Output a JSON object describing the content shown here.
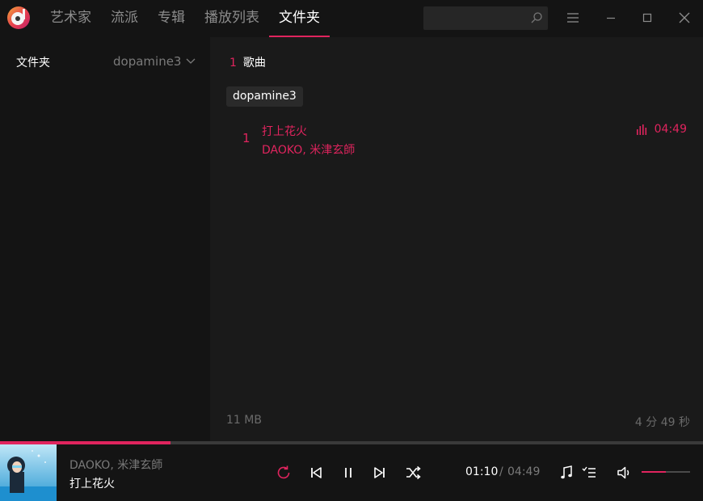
{
  "nav": {
    "items": [
      "艺术家",
      "流派",
      "专辑",
      "播放列表",
      "文件夹"
    ],
    "active_index": 4
  },
  "search": {
    "placeholder": "",
    "value": ""
  },
  "sidebar": {
    "label": "文件夹",
    "selected_folder": "dopamine3"
  },
  "main": {
    "song_count": "1",
    "song_count_label": "歌曲",
    "folder_chip": "dopamine3",
    "tracks": [
      {
        "number": "1",
        "title": "打上花火",
        "artist": "DAOKO, 米津玄師",
        "duration": "04:49",
        "playing": true
      }
    ],
    "total_size": "11 MB",
    "total_duration": "4 分 49 秒"
  },
  "player": {
    "artist": "DAOKO, 米津玄師",
    "title": "打上花火",
    "current_time": "01:10",
    "separator": "/",
    "total_time": "04:49",
    "progress_fraction": 0.243,
    "volume_fraction": 0.5
  },
  "colors": {
    "accent": "#e0245e",
    "background": "#1a1a1a",
    "panel": "#141414"
  },
  "icons": [
    "app-logo-icon",
    "search-icon",
    "menu-icon",
    "minimize-icon",
    "maximize-icon",
    "close-icon",
    "chevron-down-icon",
    "equalizer-icon",
    "album-cover",
    "repeat-icon",
    "previous-icon",
    "pause-icon",
    "next-icon",
    "shuffle-icon",
    "music-note-icon",
    "playlist-icon",
    "volume-icon"
  ]
}
